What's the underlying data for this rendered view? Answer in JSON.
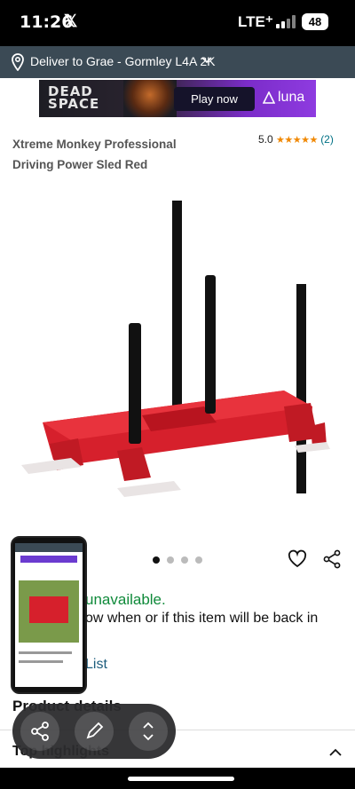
{
  "status": {
    "time": "11:26",
    "x_logo": "𝕏",
    "network": "LTE⁺",
    "battery": "48"
  },
  "deliver": {
    "text": "Deliver to Grae - Gormley L4A 2K"
  },
  "ad": {
    "game_title_line1": "DEAD",
    "game_title_line2": "SPACE",
    "play_label": "Play now",
    "brand": "luna"
  },
  "product": {
    "title_line1": "Xtreme Monkey Professional",
    "title_line2": "Driving Power Sled Red",
    "rating_value": "5.0",
    "stars": "★★★★★",
    "rating_count": "(2)"
  },
  "availability": {
    "status": "unavailable.",
    "message_line1": "ow when or if this item will be back in",
    "list_link": "List"
  },
  "sections": {
    "product_details": "Product details",
    "top_highlights": "Top highlights"
  },
  "colors": {
    "accent_orange": "#f08804",
    "deliver_bar": "#3b4a55",
    "in_stock_green": "#0f8a3a",
    "sled_red": "#d6202c"
  }
}
